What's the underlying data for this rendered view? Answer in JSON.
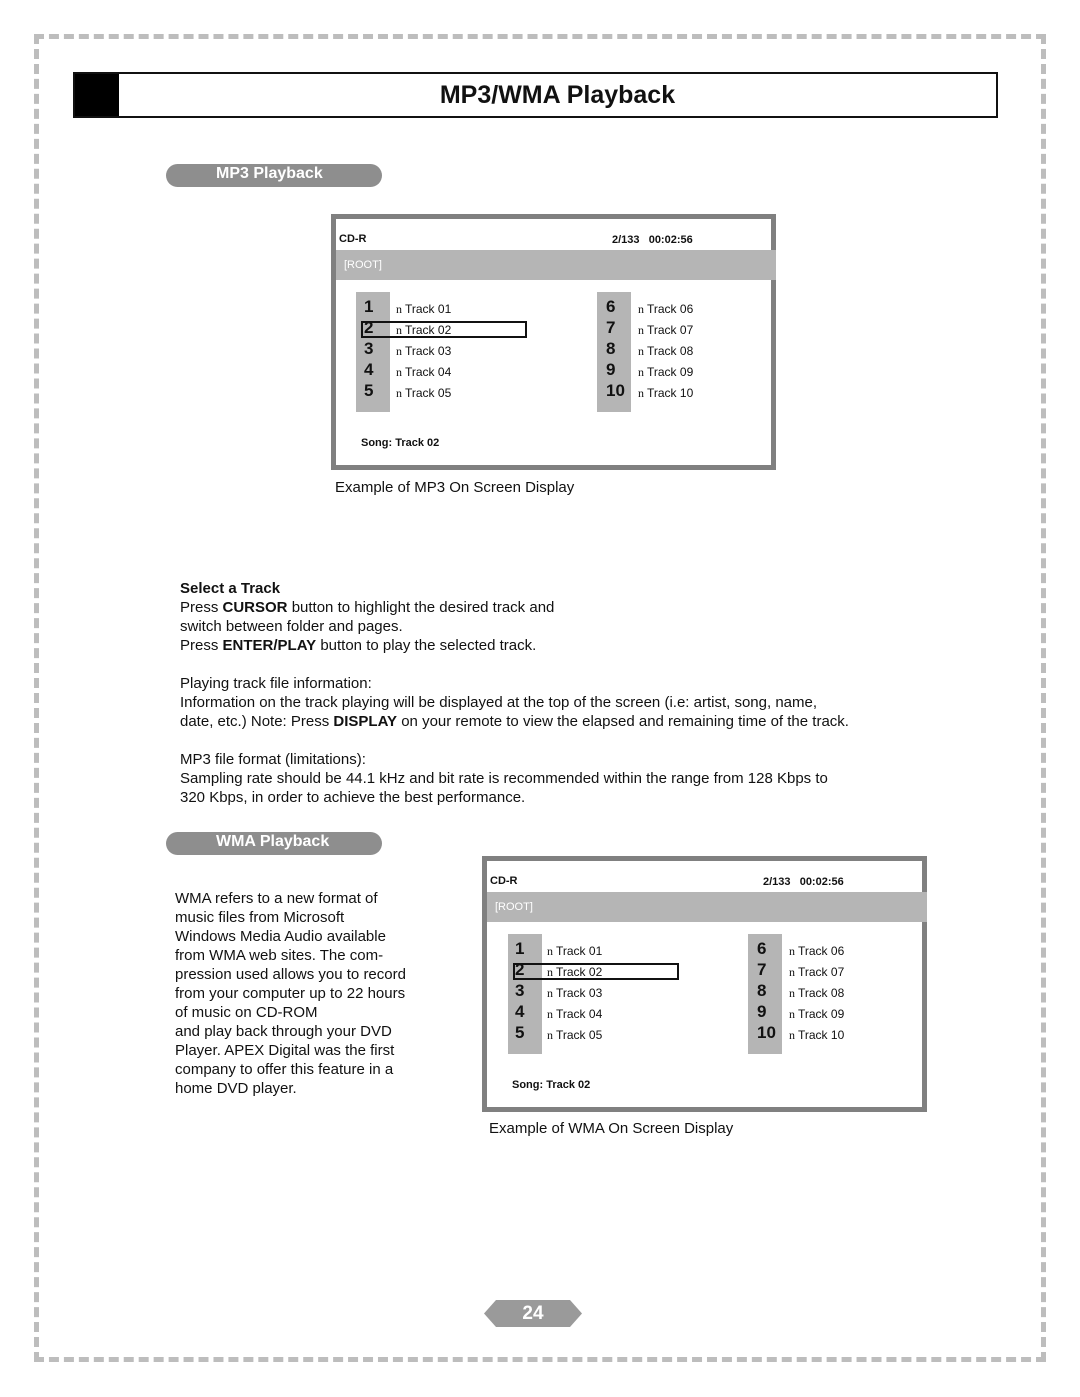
{
  "page": {
    "title": "MP3/WMA Playback",
    "page_number": "24"
  },
  "mp3": {
    "section_label": "MP3 Playback",
    "osd": {
      "disc": "CD-R",
      "counter": "2/133   00:02:56",
      "folder": "[ROOT]",
      "bullet": "n",
      "tracks": [
        {
          "num": "1",
          "label": "Track 01"
        },
        {
          "num": "2",
          "label": "Track 02"
        },
        {
          "num": "3",
          "label": "Track 03"
        },
        {
          "num": "4",
          "label": "Track 04"
        },
        {
          "num": "5",
          "label": "Track 05"
        },
        {
          "num": "6",
          "label": "Track 06"
        },
        {
          "num": "7",
          "label": "Track 07"
        },
        {
          "num": "8",
          "label": "Track 08"
        },
        {
          "num": "9",
          "label": "Track 09"
        },
        {
          "num": "10",
          "label": "Track 10"
        }
      ],
      "selected_track": "2",
      "song": "Song: Track 02"
    },
    "caption": "Example of MP3 On Screen Display",
    "select_heading": "Select a Track",
    "select_lines": {
      "l1_pre": "Press ",
      "l1_bold": "CURSOR",
      "l1_post": " button to highlight the desired track and",
      "l2": "switch between folder and pages.",
      "l3_pre": "Press ",
      "l3_bold": "ENTER/PLAY",
      "l3_post": " button to play the selected track."
    },
    "info_heading": "Playing track file information:",
    "info_lines": {
      "l1": "Information on the track playing will be displayed at the top of the screen (i.e: artist, song, name,",
      "l2_pre": "date, etc.) Note: Press ",
      "l2_bold": "DISPLAY",
      "l2_post": " on your remote to view the elapsed and remaining time of the track."
    },
    "format_heading": "MP3 file format (limitations):",
    "format_lines": {
      "l1": "Sampling rate should be 44.1 kHz and bit rate is recommended within the range from 128 Kbps to",
      "l2": "320 Kbps, in order to achieve the best performance."
    }
  },
  "wma": {
    "section_label": "WMA Playback",
    "description_lines": [
      "WMA refers to a new format of",
      "music files from Microsoft",
      "Windows Media Audio available",
      "from WMA web sites. The com-",
      "pression used allows you to record",
      "from your computer up to 22 hours",
      "of music on CD-ROM",
      "and play back through your DVD",
      "Player. APEX Digital was the first",
      "company to offer this feature in a",
      "home DVD player."
    ],
    "osd": {
      "disc": "CD-R",
      "counter": "2/133   00:02:56",
      "folder": "[ROOT]",
      "bullet": "n",
      "tracks": [
        {
          "num": "1",
          "label": "Track 01"
        },
        {
          "num": "2",
          "label": "Track 02"
        },
        {
          "num": "3",
          "label": "Track 03"
        },
        {
          "num": "4",
          "label": "Track 04"
        },
        {
          "num": "5",
          "label": "Track 05"
        },
        {
          "num": "6",
          "label": "Track 06"
        },
        {
          "num": "7",
          "label": "Track 07"
        },
        {
          "num": "8",
          "label": "Track 08"
        },
        {
          "num": "9",
          "label": "Track 09"
        },
        {
          "num": "10",
          "label": "Track 10"
        }
      ],
      "selected_track": "2",
      "song": "Song: Track 02"
    },
    "caption": "Example of WMA On Screen Display"
  }
}
